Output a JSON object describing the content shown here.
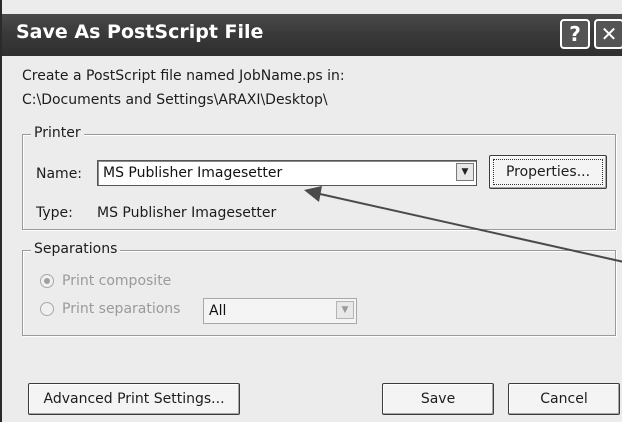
{
  "window": {
    "title": "Save As PostScript File",
    "help_label": "?",
    "close_label": "✕"
  },
  "intro": {
    "line1": "Create a PostScript file named JobName.ps in:",
    "line2": "C:\\Documents and Settings\\ARAXI\\Desktop\\"
  },
  "printer": {
    "group_label": "Printer",
    "name_label": "Name:",
    "name_value": "MS Publisher Imagesetter",
    "dropdown_arrow": "▼",
    "properties_label": "Properties...",
    "type_label": "Type:",
    "type_value": "MS Publisher Imagesetter"
  },
  "separations": {
    "group_label": "Separations",
    "option_composite": "Print composite",
    "option_separations": "Print separations",
    "selected": "Print composite",
    "enabled": false,
    "separations_value": "All",
    "dropdown_arrow": "▼"
  },
  "footer": {
    "advanced_label": "Advanced Print Settings...",
    "save_label": "Save",
    "cancel_label": "Cancel"
  },
  "annotation": {
    "color": "#4a4a4a",
    "points_to": "MS Publisher Imagesetter"
  }
}
